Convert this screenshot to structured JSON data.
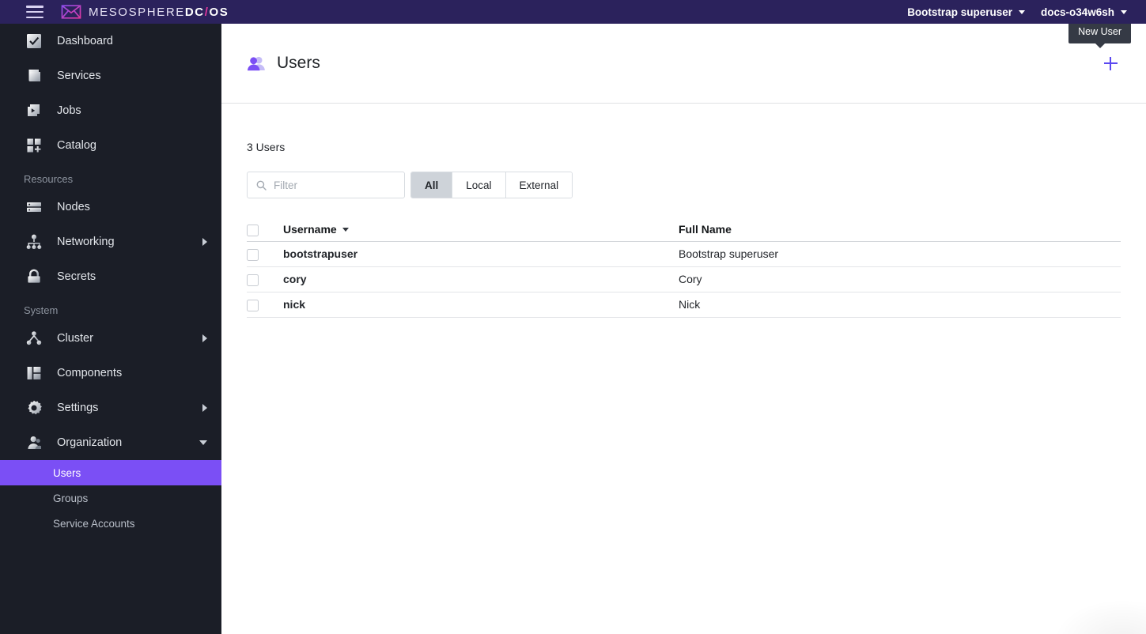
{
  "topbar": {
    "menu_icon": "hamburger-icon",
    "brand_prefix": "MESOSPHERE",
    "brand_dc": "DC",
    "brand_slash": "/",
    "brand_os": "OS",
    "user_menu": "Bootstrap superuser",
    "cluster_menu": "docs-o34w6sh",
    "background": "#2b225c"
  },
  "sidebar": {
    "primary": [
      {
        "label": "Dashboard",
        "icon": "dashboard-icon"
      },
      {
        "label": "Services",
        "icon": "services-icon"
      },
      {
        "label": "Jobs",
        "icon": "jobs-icon"
      },
      {
        "label": "Catalog",
        "icon": "catalog-icon"
      }
    ],
    "resources_heading": "Resources",
    "resources": [
      {
        "label": "Nodes",
        "icon": "nodes-icon",
        "expandable": false
      },
      {
        "label": "Networking",
        "icon": "networking-icon",
        "expandable": true
      },
      {
        "label": "Secrets",
        "icon": "secrets-icon",
        "expandable": false
      }
    ],
    "system_heading": "System",
    "system": [
      {
        "label": "Cluster",
        "icon": "cluster-icon",
        "expandable": true
      },
      {
        "label": "Components",
        "icon": "components-icon",
        "expandable": false
      },
      {
        "label": "Settings",
        "icon": "settings-gear-icon",
        "expandable": true
      },
      {
        "label": "Organization",
        "icon": "organization-icon",
        "expandable": true,
        "expanded": true
      }
    ],
    "organization_children": [
      {
        "label": "Users",
        "active": true
      },
      {
        "label": "Groups",
        "active": false
      },
      {
        "label": "Service Accounts",
        "active": false
      }
    ],
    "active_color": "#7b4ff5",
    "background": "#1b1e27"
  },
  "page": {
    "title": "Users",
    "title_icon": "users-icon",
    "add_button_icon": "plus-icon",
    "add_button_tooltip": "New User",
    "accent_color": "#5b49f0"
  },
  "toolbar": {
    "count_label": "3 Users",
    "filter_placeholder": "Filter",
    "filter_value": "",
    "filter_icon": "search-icon",
    "segments": [
      {
        "label": "All",
        "active": true
      },
      {
        "label": "Local",
        "active": false
      },
      {
        "label": "External",
        "active": false
      }
    ]
  },
  "table": {
    "columns": [
      {
        "label": "Username",
        "sorted": true,
        "sort_icon": "caret-down-icon"
      },
      {
        "label": "Full Name",
        "sorted": false
      }
    ],
    "rows": [
      {
        "username": "bootstrapuser",
        "full_name": "Bootstrap superuser",
        "selected": false
      },
      {
        "username": "cory",
        "full_name": "Cory",
        "selected": false
      },
      {
        "username": "nick",
        "full_name": "Nick",
        "selected": false
      }
    ]
  }
}
